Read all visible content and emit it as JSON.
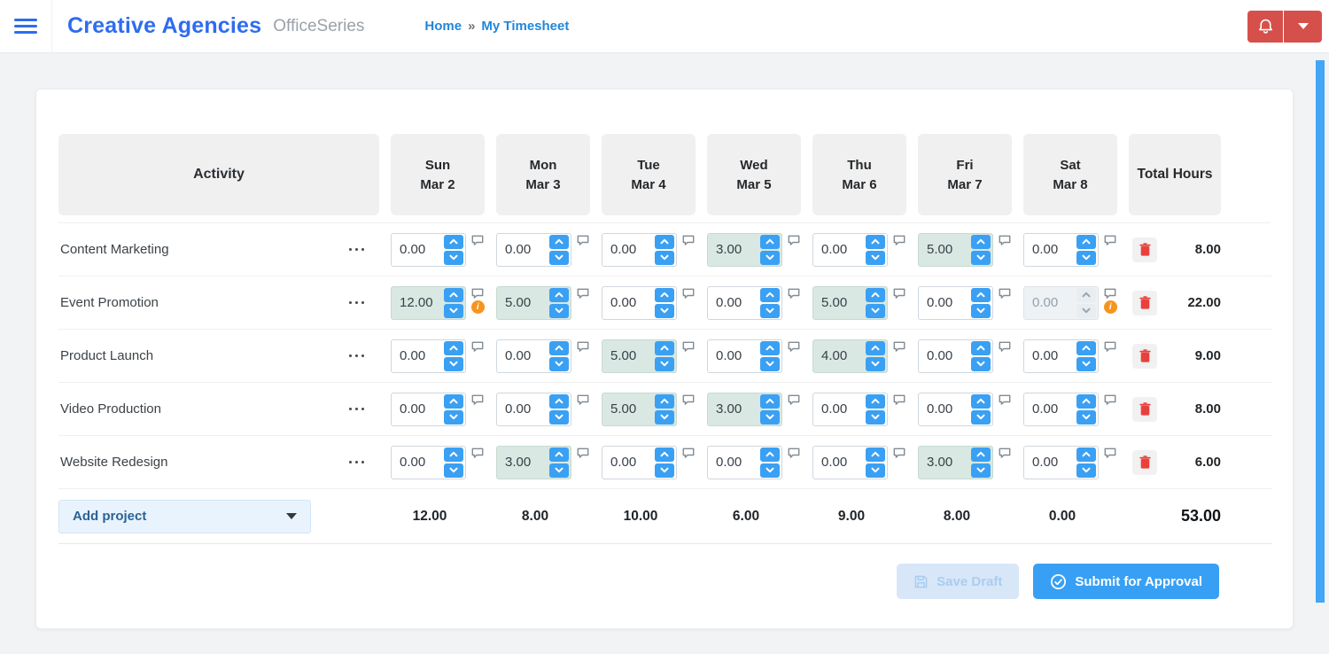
{
  "header": {
    "app_title": "Creative Agencies",
    "app_subtitle": "OfficeSeries",
    "breadcrumb": {
      "home": "Home",
      "separator": "»",
      "current": "My Timesheet"
    }
  },
  "timesheet": {
    "columns": {
      "activity": "Activity",
      "days": [
        {
          "day": "Sun",
          "date": "Mar 2"
        },
        {
          "day": "Mon",
          "date": "Mar 3"
        },
        {
          "day": "Tue",
          "date": "Mar 4"
        },
        {
          "day": "Wed",
          "date": "Mar 5"
        },
        {
          "day": "Thu",
          "date": "Mar 6"
        },
        {
          "day": "Fri",
          "date": "Mar 7"
        },
        {
          "day": "Sat",
          "date": "Mar 8"
        }
      ],
      "total": "Total Hours"
    },
    "rows": [
      {
        "activity": "Content Marketing",
        "values": [
          "0.00",
          "0.00",
          "0.00",
          "3.00",
          "0.00",
          "5.00",
          "0.00"
        ],
        "total": "8.00",
        "warnings": [],
        "disabled": []
      },
      {
        "activity": "Event Promotion",
        "values": [
          "12.00",
          "5.00",
          "0.00",
          "0.00",
          "5.00",
          "0.00",
          "0.00"
        ],
        "total": "22.00",
        "warnings": [
          0,
          6
        ],
        "disabled": [
          6
        ]
      },
      {
        "activity": "Product Launch",
        "values": [
          "0.00",
          "0.00",
          "5.00",
          "0.00",
          "4.00",
          "0.00",
          "0.00"
        ],
        "total": "9.00",
        "warnings": [],
        "disabled": []
      },
      {
        "activity": "Video Production",
        "values": [
          "0.00",
          "0.00",
          "5.00",
          "3.00",
          "0.00",
          "0.00",
          "0.00"
        ],
        "total": "8.00",
        "warnings": [],
        "disabled": []
      },
      {
        "activity": "Website Redesign",
        "values": [
          "0.00",
          "3.00",
          "0.00",
          "0.00",
          "0.00",
          "3.00",
          "0.00"
        ],
        "total": "6.00",
        "warnings": [],
        "disabled": []
      }
    ],
    "footer": {
      "add_project_label": "Add project",
      "daily_totals": [
        "12.00",
        "8.00",
        "10.00",
        "6.00",
        "9.00",
        "8.00",
        "0.00"
      ],
      "grand_total": "53.00"
    },
    "actions": {
      "save_draft_label": "Save Draft",
      "submit_label": "Submit for Approval"
    }
  },
  "colors": {
    "brand_blue": "#2e6cf0",
    "link_blue": "#2287d9",
    "accent_blue": "#3aa0f3",
    "submit_blue": "#38a0f4",
    "danger_red": "#d6504b",
    "warning_orange": "#f7941e",
    "highlight_green": "#d9e8e2",
    "disabled_bg": "#eef2f5",
    "header_cell_gray": "#f0f0f0",
    "add_project_bg": "#e9f3fd",
    "add_project_text": "#2a6395",
    "save_draft_bg": "#d8e7f8",
    "save_draft_text": "#a9cdf0",
    "scrollbar_blue": "#42a5f5"
  }
}
